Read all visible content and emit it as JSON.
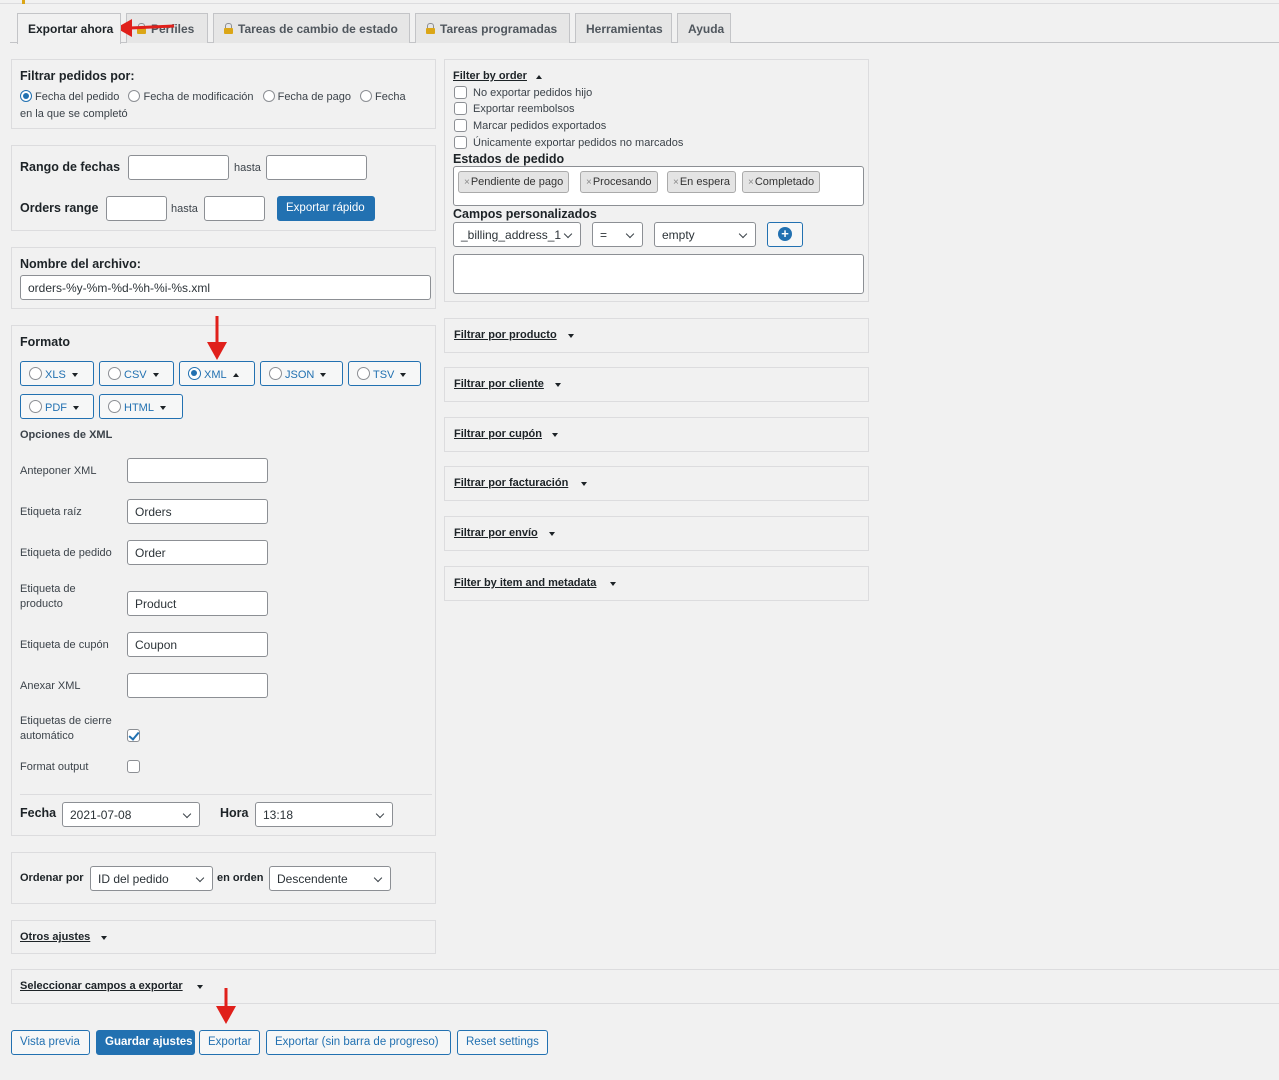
{
  "tabs": [
    {
      "label": "Exportar ahora",
      "locked": false
    },
    {
      "label": "Perfiles",
      "locked": true
    },
    {
      "label": "Tareas de cambio de estado",
      "locked": true
    },
    {
      "label": "Tareas programadas",
      "locked": true
    },
    {
      "label": "Herramientas",
      "locked": false
    },
    {
      "label": "Ayuda",
      "locked": false
    }
  ],
  "filter_orders": {
    "title": "Filtrar pedidos por:",
    "options": [
      "Fecha del pedido",
      "Fecha de modificación",
      "Fecha de pago",
      "Fecha",
      "en la que se completó"
    ],
    "selected": "Fecha del pedido"
  },
  "date_range": {
    "label": "Rango de fechas",
    "to": "hasta",
    "from_value": "",
    "to_value": "",
    "orders_range_label": "Orders range",
    "orders_to": "hasta",
    "quick_export": "Exportar rápido"
  },
  "file_name": {
    "label": "Nombre del archivo:",
    "value": "orders-%y-%m-%d-%h-%i-%s.xml"
  },
  "format": {
    "title": "Formato",
    "options": [
      "XLS",
      "CSV",
      "XML",
      "JSON",
      "TSV",
      "PDF",
      "HTML"
    ],
    "selected": "XML",
    "xml_options_title": "Opciones de XML",
    "fields": {
      "prepend_label": "Anteponer XML",
      "prepend_value": "",
      "root_label": "Etiqueta raíz",
      "root_value": "Orders",
      "order_label": "Etiqueta de pedido",
      "order_value": "Order",
      "product_label_1": "Etiqueta de",
      "product_label_2": "producto",
      "product_value": "Product",
      "coupon_label": "Etiqueta de cupón",
      "coupon_value": "Coupon",
      "append_label": "Anexar XML",
      "append_value": "",
      "autoclose_label_1": "Etiquetas de cierre",
      "autoclose_label_2": "automático",
      "autoclose_checked": true,
      "format_output_label": "Format output",
      "format_output_checked": false
    },
    "date_label": "Fecha",
    "date_value": "2021-07-08",
    "time_label": "Hora",
    "time_value": "13:18"
  },
  "sort": {
    "label": "Ordenar por",
    "value": "ID del pedido",
    "order_label": "en orden",
    "order_value": "Descendente"
  },
  "other_settings": "Otros ajustes",
  "select_fields": "Seleccionar campos a exportar",
  "buttons": {
    "preview": "Vista previa",
    "save": "Guardar ajustes",
    "export": "Exportar",
    "export_no_progress": "Exportar (sin barra de progreso)",
    "reset": "Reset settings"
  },
  "filter_by_order": {
    "title": "Filter by order",
    "checkboxes": [
      "No exportar pedidos hijo",
      "Exportar reembolsos",
      "Marcar pedidos exportados",
      "Únicamente exportar pedidos no marcados"
    ],
    "statuses_title": "Estados de pedido",
    "statuses": [
      "Pendiente de pago",
      "Procesando",
      "En espera",
      "Completado"
    ],
    "custom_fields_title": "Campos personalizados",
    "custom_field": "_billing_address_1",
    "operator": "=",
    "value": "empty"
  },
  "accordions": [
    "Filtrar por producto",
    "Filtrar por cliente",
    "Filtrar por cupón",
    "Filtrar por facturación",
    "Filtrar por envío",
    "Filter by item and metadata"
  ],
  "colors": {
    "accent": "#2271b1",
    "arrow": "#e0201b",
    "background": "#f1f1f1"
  }
}
